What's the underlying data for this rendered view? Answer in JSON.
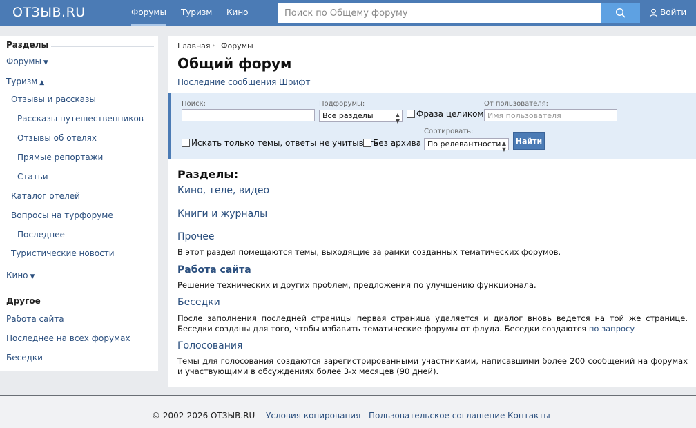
{
  "header": {
    "logo": "ОТЗЫВ.RU",
    "nav": [
      {
        "label": "Форумы"
      },
      {
        "label": "Туризм"
      },
      {
        "label": "Кино"
      }
    ],
    "search_placeholder": "Поиск по Общему форуму",
    "login_label": "Войти"
  },
  "sidebar": {
    "sections_heading": "Разделы",
    "forums_label": "Форумы",
    "tourism_label": "Туризм",
    "tourism_items": [
      "Отзывы и рассказы",
      "Рассказы путешественников",
      "Отзывы об отелях",
      "Прямые репортажи",
      "Статьи",
      "Каталог отелей",
      "Вопросы на турфоруме",
      "Последнее",
      "Туристические новости"
    ],
    "kino_label": "Кино",
    "other_heading": "Другое",
    "other_items": [
      "Работа сайта",
      "Последнее на всех форумах",
      "Беседки"
    ]
  },
  "breadcrumb": {
    "home": "Главная",
    "current": "Форумы"
  },
  "page_title": "Общий форум",
  "sub_links": {
    "latest": "Последние сообщения",
    "font": "Шрифт"
  },
  "filter": {
    "search_label": "Поиск:",
    "search_value": "",
    "subforums_label": "Подфорумы:",
    "subforums_value": "Все разделы",
    "exact_phrase_label": "Фраза целиком",
    "from_user_label": "От пользователя:",
    "from_user_placeholder": "Имя пользователя",
    "topics_only_label": "Искать только темы, ответы не учитывать",
    "no_archive_label": "Без архива",
    "sort_label": "Сортировать:",
    "sort_value": "По релевантности",
    "submit_label": "Найти"
  },
  "sections": {
    "heading": "Разделы:",
    "items": [
      {
        "title": "Кино, теле, видео",
        "desc": ""
      },
      {
        "title": "Книги и журналы",
        "desc": ""
      },
      {
        "title": "Прочее",
        "desc": "В этот раздел помещаются темы, выходящие за рамки созданных тематических форумов."
      },
      {
        "title": "Работа сайта",
        "desc": "Решение технических и других проблем, предложения по улучшению функционала."
      },
      {
        "title": "Беседки",
        "desc": "После заполнения последней страницы первая страница удаляется и диалог вновь ведется на той же странице. Беседки созданы для того, чтобы избавить тематические форумы от флуда. Беседки создаются",
        "desc_link": "по запросу"
      },
      {
        "title": "Голосования",
        "desc": "Темы для голосования создаются зарегистрированными участниками, написавшими более 200 сообщений на форумах и участвующими в обсуждениях более 3-х месяцев (90 дней)."
      }
    ]
  },
  "footer": {
    "copyright": "© 2002-2026 ОТЗЫВ.RU",
    "links": [
      "Условия копирования",
      "Пользовательское соглашение",
      "Контакты"
    ]
  },
  "colors": {
    "header_bg": "#4b7bb5",
    "link": "#2b4f7e",
    "filter_bg": "#e3edf8",
    "search_button": "#5ea1e2"
  },
  "icons": {
    "search": "magnifier-icon",
    "login": "user-icon"
  }
}
